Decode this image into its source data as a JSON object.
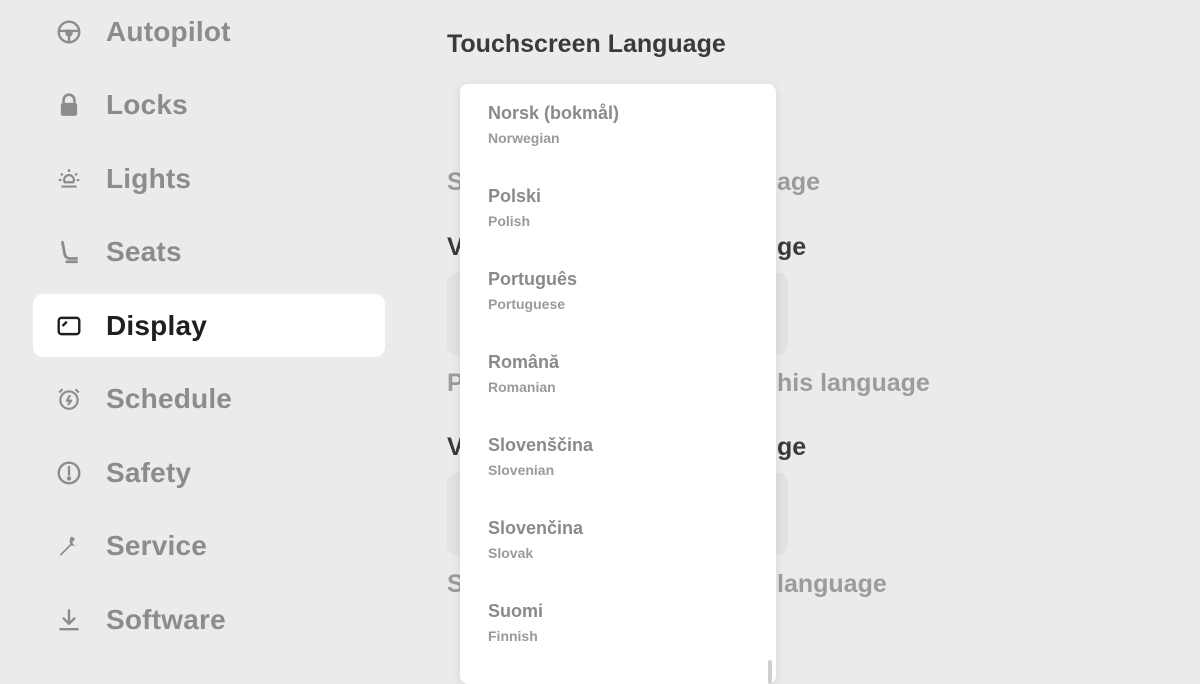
{
  "sidebar": {
    "items": [
      {
        "label": "Autopilot",
        "icon": "steering-wheel-icon"
      },
      {
        "label": "Locks",
        "icon": "lock-icon"
      },
      {
        "label": "Lights",
        "icon": "sun-icon"
      },
      {
        "label": "Seats",
        "icon": "seat-icon"
      },
      {
        "label": "Display",
        "icon": "display-icon",
        "active": true
      },
      {
        "label": "Schedule",
        "icon": "alarm-clock-icon"
      },
      {
        "label": "Safety",
        "icon": "exclamation-circle-icon"
      },
      {
        "label": "Service",
        "icon": "wrench-icon"
      },
      {
        "label": "Software",
        "icon": "download-icon"
      }
    ]
  },
  "content": {
    "title": "Touchscreen Language",
    "row1_prefix": "S",
    "row1_suffix": "age",
    "head2_prefix": "V",
    "head2_suffix": "ge",
    "row2_prefix": "P",
    "row2_suffix": "his language",
    "head3_prefix": "V",
    "head3_suffix": "ge",
    "row3_prefix": "S",
    "row3_suffix": "language"
  },
  "dropdown": {
    "options": [
      {
        "native": "Norsk (bokmål)",
        "english": "Norwegian"
      },
      {
        "native": "Polski",
        "english": "Polish"
      },
      {
        "native": "Português",
        "english": "Portuguese"
      },
      {
        "native": "Română",
        "english": "Romanian"
      },
      {
        "native": "Slovenščina",
        "english": "Slovenian"
      },
      {
        "native": "Slovenčina",
        "english": "Slovak"
      },
      {
        "native": "Suomi",
        "english": "Finnish"
      }
    ]
  },
  "colors": {
    "background": "#ebebeb",
    "active_item_bg": "#ffffff",
    "active_text": "#1f1f1f",
    "inactive_text": "#8c8c8c"
  }
}
